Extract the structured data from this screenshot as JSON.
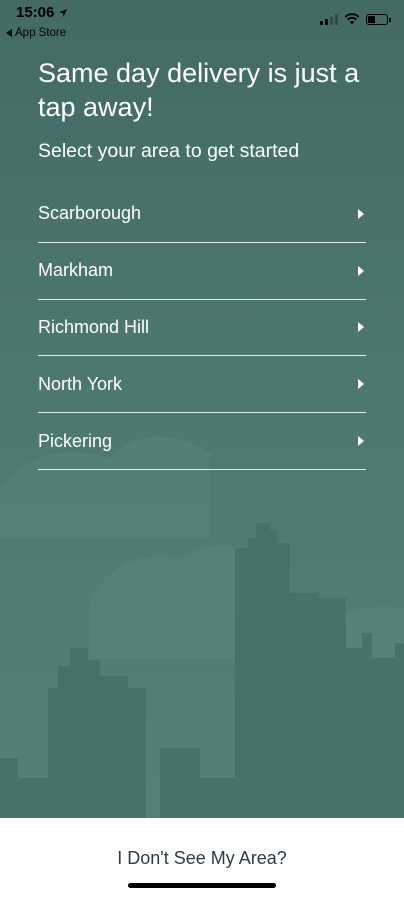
{
  "status_bar": {
    "time": "15:06",
    "back_app_label": "App Store",
    "battery_level": 0.4,
    "signal_bars_active": 2
  },
  "main": {
    "headline": "Same day delivery is just a tap away!",
    "subhead": "Select your area to get started",
    "areas": [
      {
        "label": "Scarborough"
      },
      {
        "label": "Markham"
      },
      {
        "label": "Richmond Hill"
      },
      {
        "label": "North York"
      },
      {
        "label": "Pickering"
      }
    ]
  },
  "footer": {
    "no_area_label": "I Don't See My Area?"
  },
  "colors": {
    "background": "#4d7771",
    "skyline": "#47716b",
    "cloud": "#5a847e",
    "text_primary": "#ffffff",
    "footer_text": "#2b3d45"
  }
}
